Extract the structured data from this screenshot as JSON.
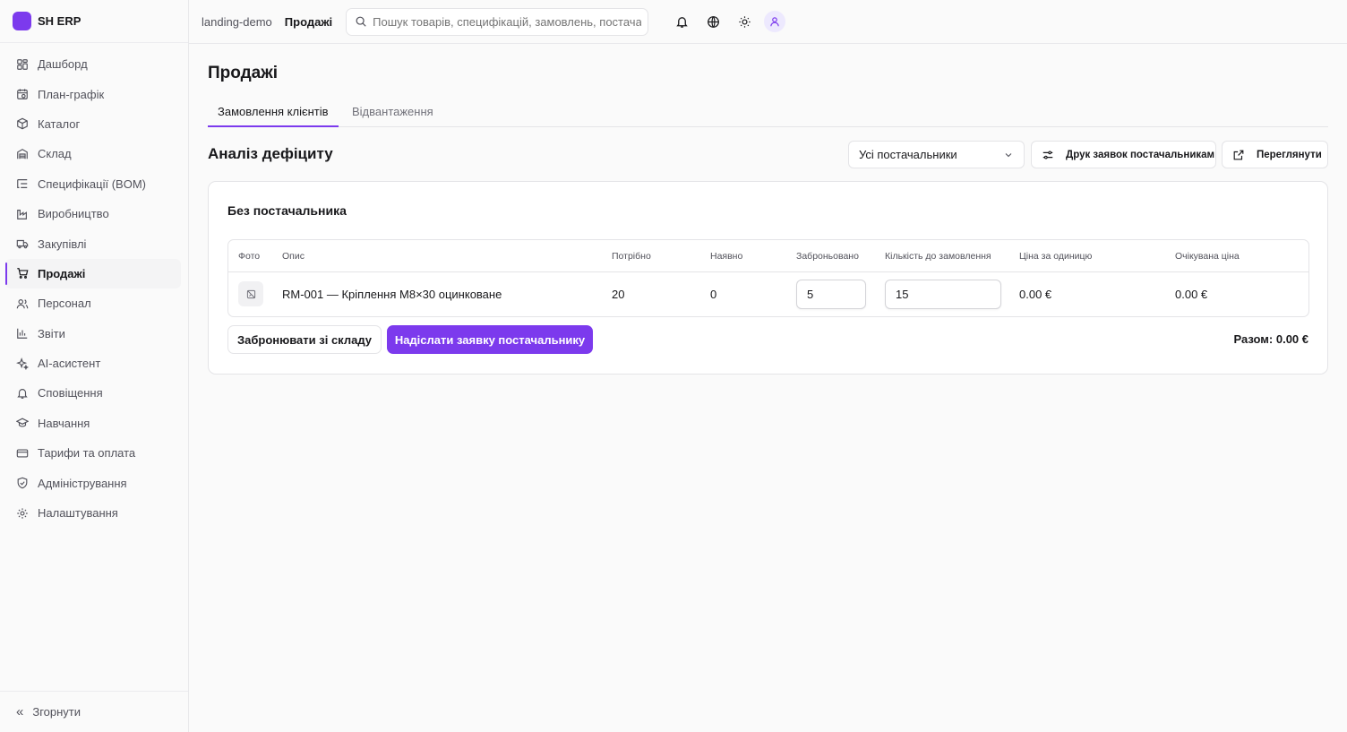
{
  "brand": {
    "name": "SH ERP",
    "accent": "#7c3aed"
  },
  "sidebar": {
    "items": [
      {
        "label": "Дашборд",
        "icon": "dashboard-icon"
      },
      {
        "label": "План-графік",
        "icon": "calendar-clock-icon"
      },
      {
        "label": "Каталог",
        "icon": "box-icon"
      },
      {
        "label": "Склад",
        "icon": "warehouse-icon"
      },
      {
        "label": "Специфікації (BOM)",
        "icon": "list-tree-icon"
      },
      {
        "label": "Виробництво",
        "icon": "factory-icon"
      },
      {
        "label": "Закупівлі",
        "icon": "truck-icon"
      },
      {
        "label": "Продажі",
        "icon": "cart-icon",
        "active": true
      },
      {
        "label": "Персонал",
        "icon": "users-icon"
      },
      {
        "label": "Звіти",
        "icon": "bar-chart-icon"
      },
      {
        "label": "AI-асистент",
        "icon": "sparkles-icon"
      },
      {
        "label": "Сповіщення",
        "icon": "bell-icon"
      },
      {
        "label": "Навчання",
        "icon": "graduation-cap-icon"
      },
      {
        "label": "Тарифи та оплата",
        "icon": "credit-card-icon"
      },
      {
        "label": "Адміністрування",
        "icon": "shield-check-icon"
      },
      {
        "label": "Налаштування",
        "icon": "gear-icon"
      }
    ],
    "collapse_label": "Згорнути"
  },
  "topbar": {
    "workspace": "landing-demo",
    "section": "Продажі",
    "search_placeholder": "Пошук товарів, специфікацій, замовлень, постачальників"
  },
  "page": {
    "title": "Продажі",
    "tabs": [
      "Замовлення клієнтів",
      "Відвантаження"
    ],
    "active_tab": 0
  },
  "deficit": {
    "title": "Аналіз дефіциту",
    "supplier_filter": "Усі постачальники",
    "print_button": "Друк заявок постачальникам",
    "view_button": "Переглянути",
    "group": {
      "title": "Без постачальника",
      "columns": [
        "Фото",
        "Опис",
        "Потрібно",
        "Наявно",
        "Заброньовано",
        "Кількість до замовлення",
        "Ціна за одиницю",
        "Очікувана ціна"
      ],
      "rows": [
        {
          "description": "RM-001 — Кріплення М8×30 оцинковане",
          "needed": "20",
          "available": "0",
          "reserved": "5",
          "order_qty": "15",
          "unit_price": "0.00 €",
          "expected_price": "0.00 €"
        }
      ],
      "reserve_button": "Забронювати зі складу",
      "send_button": "Надіслати заявку постачальнику",
      "total": "Разом: 0.00 €"
    }
  }
}
